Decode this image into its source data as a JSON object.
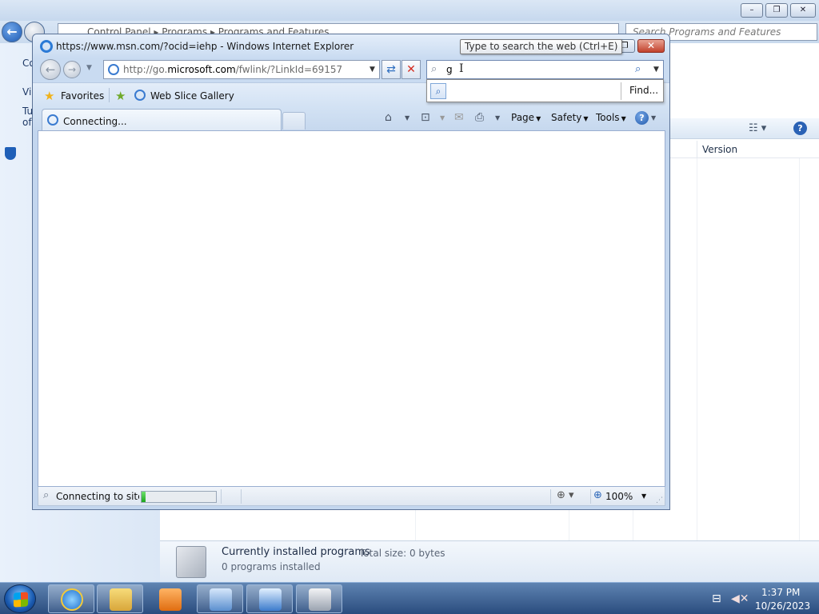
{
  "background_window": {
    "breadcrumb": [
      "Control Panel",
      "Programs",
      "Programs and Features"
    ],
    "search_placeholder": "Search Programs and Features",
    "left_pane": {
      "item1": "Co",
      "item2": "Vi",
      "item3": "Tu",
      "item4": "of"
    },
    "columns": {
      "version": "Version"
    },
    "details": {
      "title": "Currently installed programs",
      "total_size": "Total size: 0 bytes",
      "count": "0 programs installed"
    },
    "caption_buttons": {
      "minimize": "–",
      "maximize": "❐",
      "close": "✕"
    }
  },
  "ie": {
    "title": "https://www.msn.com/?ocid=iehp - Windows Internet Explorer",
    "address": {
      "prefix": "http://go.",
      "domain": "microsoft.com",
      "suffix": "/fwlink/?LinkId=69157"
    },
    "search_text": "g",
    "tooltip": "Type to search the web (Ctrl+E)",
    "search_dropdown": {
      "find": "Find..."
    },
    "favorites": {
      "label": "Favorites",
      "web_slice": "Web Slice Gallery"
    },
    "tab": {
      "label": "Connecting..."
    },
    "commands": {
      "page": "Page",
      "safety": "Safety",
      "tools": "Tools"
    },
    "status": {
      "text": "Connecting to site...",
      "progress": 0.05,
      "zoom": "100%"
    },
    "caption_buttons": {
      "maximize": "❐",
      "close": "✕"
    }
  },
  "taskbar": {
    "time": "1:37 PM",
    "date": "10/26/2023"
  },
  "icons": [
    "back-arrow-icon",
    "forward-arrow-icon",
    "ie-logo-icon",
    "refresh-icon",
    "stop-icon",
    "search-icon",
    "star-icon",
    "add-favorite-icon",
    "home-icon",
    "rss-icon",
    "mail-icon",
    "print-icon",
    "help-icon",
    "zoom-icon",
    "windows-flag-icon"
  ],
  "colors": {
    "accent": "#2b66b8",
    "close": "#c2412c",
    "progress": "#1ea61e"
  }
}
